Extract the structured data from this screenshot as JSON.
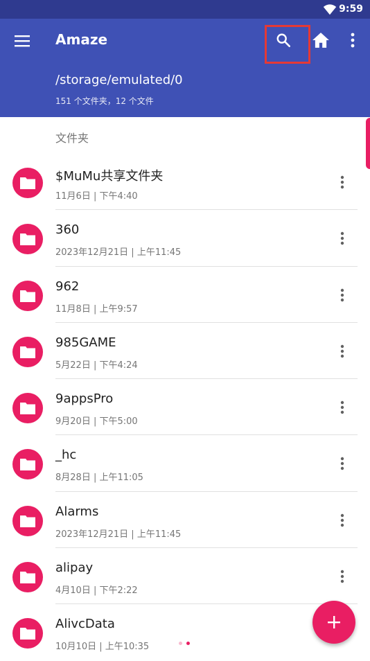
{
  "status_bar": {
    "time": "9:59",
    "wifi_icon": "wifi-icon"
  },
  "app_bar": {
    "title": "Amaze",
    "path": "/storage/emulated/0",
    "summary": "151 个文件夹，12 个文件",
    "icons": [
      "menu-icon",
      "search-icon",
      "home-icon",
      "more-vert-icon"
    ],
    "color": "#3f51b5"
  },
  "section_header": "文件夹",
  "folders": [
    {
      "name": "$MuMu共享文件夹",
      "date": "11月6日 | 下午4:40"
    },
    {
      "name": "360",
      "date": "2023年12月21日 | 上午11:45"
    },
    {
      "name": "962",
      "date": "11月8日 | 上午9:57"
    },
    {
      "name": "985GAME",
      "date": "5月22日 | 下午4:24"
    },
    {
      "name": "9appsPro",
      "date": "9月20日 | 下午5:00"
    },
    {
      "name": "_hc",
      "date": "8月28日 | 上午11:05"
    },
    {
      "name": "Alarms",
      "date": "2023年12月21日 | 上午11:45"
    },
    {
      "name": "alipay",
      "date": "4月10日 | 下午2:22"
    },
    {
      "name": "AlivcData",
      "date": "10月10日 | 上午10:35"
    }
  ],
  "fab": {
    "icon": "plus-icon",
    "color": "#e91e63"
  },
  "accent_color": "#e91e63"
}
